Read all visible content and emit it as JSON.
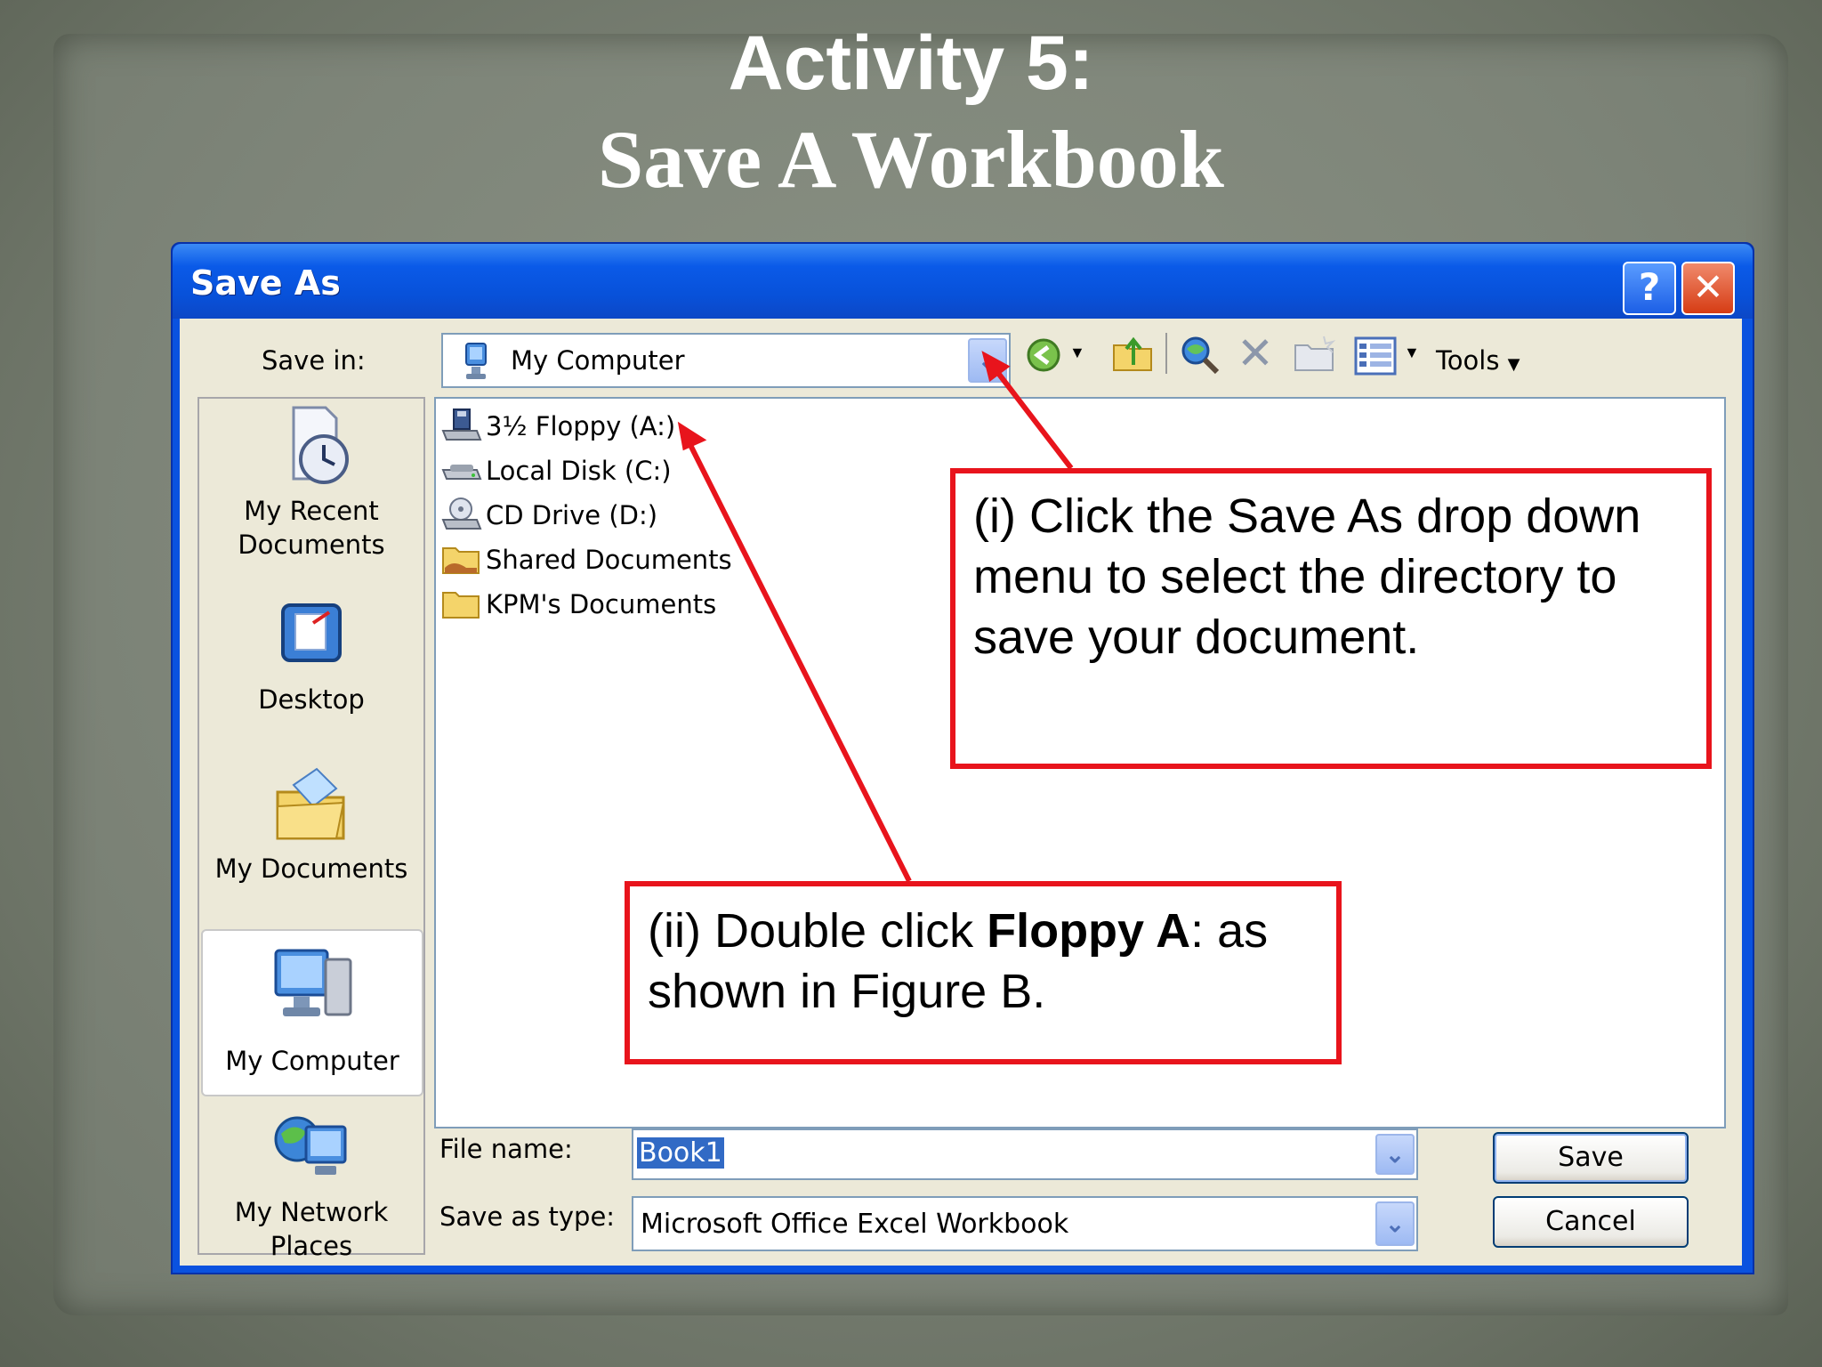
{
  "slide": {
    "title_line1": "Activity 5:",
    "title_line2": "Save A Workbook"
  },
  "dialog": {
    "title": "Save As",
    "help_label": "?",
    "close_label": "✕",
    "save_in_label": "Save in:",
    "save_in_value": "My Computer",
    "tools_label": "Tools",
    "places": [
      {
        "label_line1": "My Recent",
        "label_line2": "Documents",
        "icon": "recent-documents-icon"
      },
      {
        "label_line1": "Desktop",
        "label_line2": "",
        "icon": "desktop-icon"
      },
      {
        "label_line1": "My Documents",
        "label_line2": "",
        "icon": "my-documents-icon"
      },
      {
        "label_line1": "My Computer",
        "label_line2": "",
        "icon": "my-computer-icon",
        "selected": true
      },
      {
        "label_line1": "My Network",
        "label_line2": "Places",
        "icon": "network-places-icon"
      }
    ],
    "files": [
      {
        "label": "3½ Floppy (A:)",
        "icon": "floppy-drive-icon"
      },
      {
        "label": "Local Disk (C:)",
        "icon": "hard-disk-icon"
      },
      {
        "label": "CD Drive (D:)",
        "icon": "cd-drive-icon"
      },
      {
        "label": "Shared Documents",
        "icon": "shared-folder-icon"
      },
      {
        "label": "KPM's Documents",
        "icon": "folder-icon"
      }
    ],
    "file_name_label": "File name:",
    "file_name_value": "Book1",
    "save_as_type_label": "Save as type:",
    "save_as_type_value": "Microsoft Office Excel Workbook",
    "save_button": "Save",
    "cancel_button": "Cancel"
  },
  "callouts": {
    "callout1_line1": "(i) Click the Save As drop down",
    "callout1_line2": "menu to select the directory to",
    "callout1_line3": "save your document.",
    "callout2_part1": "(ii) Double click ",
    "callout2_bold1": "Floppy  A",
    "callout2_part2": ": as",
    "callout2_line2": "shown in Figure B."
  },
  "colors": {
    "accent_red": "#e8141c",
    "xp_blue": "#0a52df"
  }
}
